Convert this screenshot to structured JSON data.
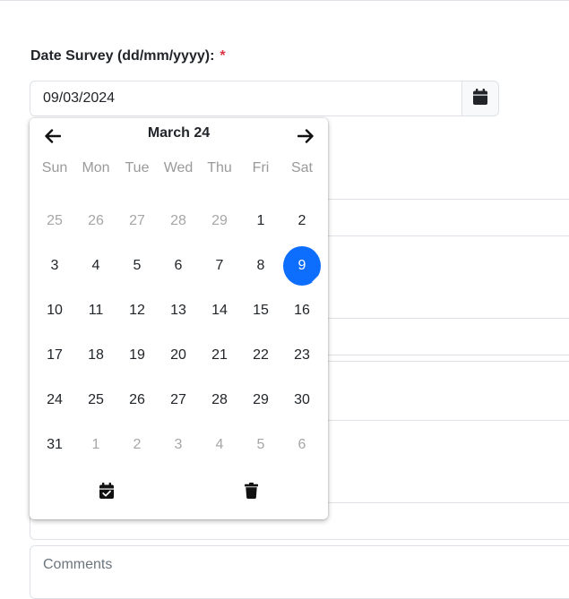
{
  "form": {
    "date_label": "Date Survey (dd/mm/yyyy):",
    "required_mark": "*",
    "date_value": "09/03/2024",
    "comments_placeholder": "Comments"
  },
  "picker": {
    "month_title": "March 24",
    "weekdays": [
      "Sun",
      "Mon",
      "Tue",
      "Wed",
      "Thu",
      "Fri",
      "Sat"
    ],
    "weeks": [
      [
        {
          "d": "25",
          "muted": true
        },
        {
          "d": "26",
          "muted": true
        },
        {
          "d": "27",
          "muted": true
        },
        {
          "d": "28",
          "muted": true
        },
        {
          "d": "29",
          "muted": true
        },
        {
          "d": "1"
        },
        {
          "d": "2"
        }
      ],
      [
        {
          "d": "3"
        },
        {
          "d": "4"
        },
        {
          "d": "5"
        },
        {
          "d": "6"
        },
        {
          "d": "7"
        },
        {
          "d": "8"
        },
        {
          "d": "9",
          "selected": true
        }
      ],
      [
        {
          "d": "10"
        },
        {
          "d": "11"
        },
        {
          "d": "12"
        },
        {
          "d": "13"
        },
        {
          "d": "14"
        },
        {
          "d": "15"
        },
        {
          "d": "16"
        }
      ],
      [
        {
          "d": "17"
        },
        {
          "d": "18"
        },
        {
          "d": "19"
        },
        {
          "d": "20"
        },
        {
          "d": "21"
        },
        {
          "d": "22"
        },
        {
          "d": "23"
        }
      ],
      [
        {
          "d": "24"
        },
        {
          "d": "25"
        },
        {
          "d": "26"
        },
        {
          "d": "27"
        },
        {
          "d": "28"
        },
        {
          "d": "29"
        },
        {
          "d": "30"
        }
      ],
      [
        {
          "d": "31"
        },
        {
          "d": "1",
          "muted": true
        },
        {
          "d": "2",
          "muted": true
        },
        {
          "d": "3",
          "muted": true
        },
        {
          "d": "4",
          "muted": true
        },
        {
          "d": "5",
          "muted": true
        },
        {
          "d": "6",
          "muted": true
        }
      ]
    ],
    "icons": {
      "prev": "arrow-left-icon",
      "next": "arrow-right-icon",
      "today": "calendar-check-icon",
      "clear": "trash-icon",
      "toggle": "calendar-icon"
    },
    "selected_color": "#0d6efd"
  }
}
